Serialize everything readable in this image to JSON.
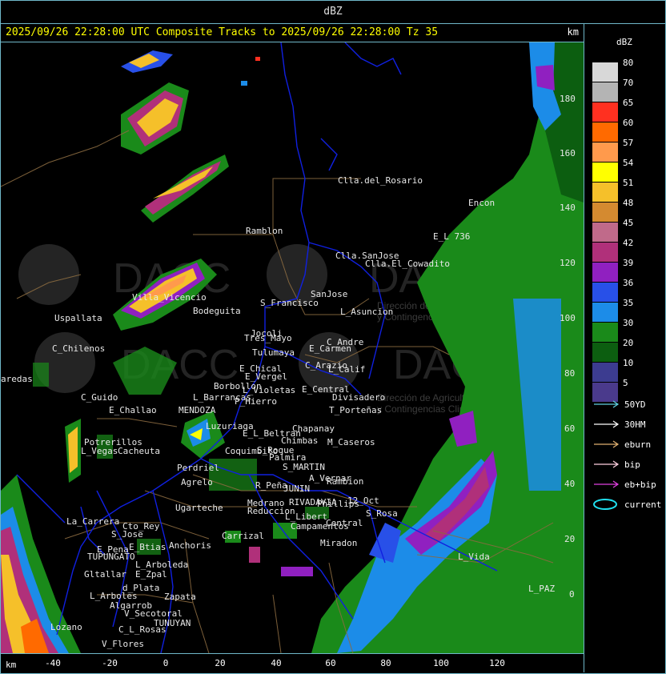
{
  "window_title": "dBZ",
  "header": {
    "text": "2025/09/26 22:28:00 UTC Composite Tracks to 2025/09/26 22:28:00 Tz 35",
    "unit": "km"
  },
  "axes": {
    "x_unit": "km",
    "x_ticks": [
      "-40",
      "-20",
      "0",
      "20",
      "40",
      "60",
      "80",
      "100",
      "120"
    ],
    "y_ticks": [
      "180",
      "160",
      "140",
      "120",
      "100",
      "80",
      "60",
      "40",
      "20",
      "0"
    ]
  },
  "legend": {
    "title": "dBZ",
    "scale": [
      {
        "label": "80",
        "color": "#d8d8d8"
      },
      {
        "label": "70",
        "color": "#b4b4b4"
      },
      {
        "label": "65",
        "color": "#ff3020"
      },
      {
        "label": "60",
        "color": "#ff6a00"
      },
      {
        "label": "57",
        "color": "#ff9a4c"
      },
      {
        "label": "54",
        "color": "#ffff00"
      },
      {
        "label": "51",
        "color": "#f5c02a"
      },
      {
        "label": "48",
        "color": "#d48a30"
      },
      {
        "label": "45",
        "color": "#c06a8a"
      },
      {
        "label": "42",
        "color": "#b0307a"
      },
      {
        "label": "39",
        "color": "#9020c0"
      },
      {
        "label": "36",
        "color": "#2850e8"
      },
      {
        "label": "35",
        "color": "#1c8ce8"
      },
      {
        "label": "30",
        "color": "#1a8a1a"
      },
      {
        "label": "20",
        "color": "#0c5e10"
      },
      {
        "label": "10",
        "color": "#3c3c90"
      },
      {
        "label": "5",
        "color": "#4a3a8c"
      }
    ],
    "tracks": [
      {
        "label": "50YD",
        "color": "#5fd0e0"
      },
      {
        "label": "30HM",
        "color": "#ffffff"
      },
      {
        "label": "eburn",
        "color": "#e0b070"
      },
      {
        "label": "bip",
        "color": "#ffd0e0"
      },
      {
        "label": "eb+bip",
        "color": "#e040e0"
      },
      {
        "label": "current",
        "color": "#20e0f0"
      }
    ]
  },
  "watermark": {
    "name": "DACC",
    "line1": "Dirección de Agricultura",
    "line2": "y Contingencias Climáticas"
  },
  "places": [
    "Clla.del_Rosario",
    "Encon",
    "Ramblon",
    "Clla.SanJose",
    "Clla.El_Cowadito",
    "E_L 736",
    "SanJose",
    "S_Francisco",
    "L_Asuncion",
    "Uspallata",
    "Jocoli",
    "Tres_Mayo",
    "C_Andre",
    "C_Chilenos",
    "Tulumaya",
    "E_Carmen",
    "E_Chical",
    "C_Arazio",
    "L_Calif",
    "E_Vergel",
    "Borbollon",
    "L_Violetas",
    "E_Central",
    "Divisadero",
    "C_Guido",
    "P_Hierro",
    "T_Porteñas",
    "E_Challao",
    "MENDOZA",
    "L_Barrancas",
    "Chapanay",
    "Potrerillos",
    "Chimbas",
    "M_Caseros",
    "L_Vegas",
    "Cacheuta",
    "S_Roque",
    "Palmira",
    "S_MARTIN",
    "A_Vernar",
    "Perdriel",
    "Agrelo",
    "R_Peña",
    "JUNIN",
    "Rambion",
    "Ugarteche",
    "Medrano",
    "RIVADAVIA",
    "Phillips",
    "12_Oct",
    "Reduccion",
    "L_Libert",
    "Campamentos",
    "Central",
    "Miradon",
    "La_Carrera",
    "Cto_Rey",
    "S_Jose",
    "E_Btias",
    "Anchoris",
    "Carrizal",
    "E_Pena",
    "TUPUNGATO",
    "L_Arboleda",
    "Gltallar",
    "E_Zpal",
    "d_Plata",
    "L_Arboles",
    "Zapata",
    "Algarrob",
    "V_Secotoral",
    "TUNUYAN",
    "C_L_Rosas",
    "V_Flores",
    "Lozano",
    "L_PAZ",
    "S_Rosa",
    "L_Vida",
    "aredas",
    "Luzuriaga",
    "Coquimbito",
    "E_L_Beltran",
    "Bodeguita",
    "Villa_Vicencio"
  ]
}
